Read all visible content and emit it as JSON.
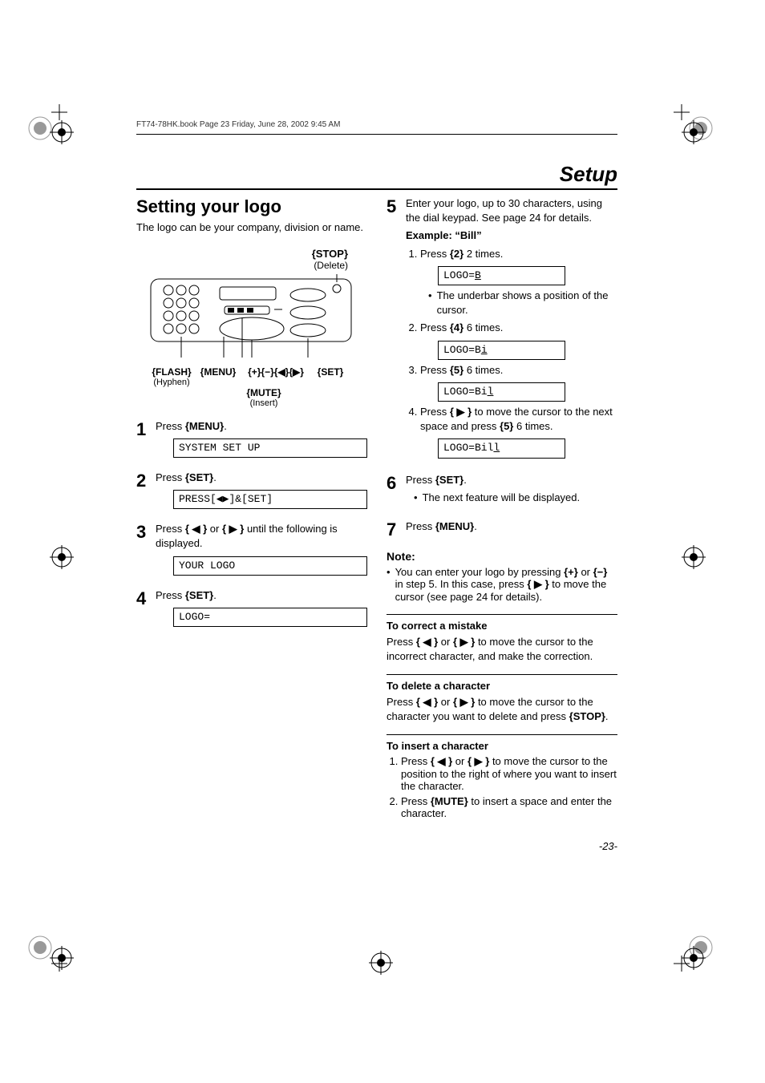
{
  "header": {
    "running": "FT74-78HK.book  Page 23  Friday, June 28, 2002  9:45 AM"
  },
  "section": "Setup",
  "title": "Setting your logo",
  "intro": "The logo can be your company, division or name.",
  "diagram": {
    "stop_label": "{STOP}",
    "stop_sub": "(Delete)",
    "flash_label": "{FLASH}",
    "flash_sub": "(Hyphen)",
    "menu_label": "{MENU}",
    "set_label": "{SET}",
    "arrows": "{+}{−}{◀}{▶}",
    "mute_label": "{MUTE}",
    "mute_sub": "(Insert)"
  },
  "left_steps": {
    "s1": {
      "num": "1",
      "text_a": "Press ",
      "btn": "{MENU}",
      "text_b": ".",
      "lcd": "SYSTEM SET UP"
    },
    "s2": {
      "num": "2",
      "text_a": "Press ",
      "btn": "{SET}",
      "text_b": ".",
      "lcd": "PRESS[◀▶]&[SET]"
    },
    "s3": {
      "num": "3",
      "text_a": "Press ",
      "btn1": "{ ◀ }",
      "text_mid": " or ",
      "btn2": "{ ▶ }",
      "text_b": " until the following is displayed.",
      "lcd": "YOUR LOGO"
    },
    "s4": {
      "num": "4",
      "text_a": "Press ",
      "btn": "{SET}",
      "text_b": ".",
      "lcd": "LOGO="
    }
  },
  "right_steps": {
    "s5": {
      "num": "5",
      "intro": "Enter your logo, up to 30 characters, using the dial keypad. See page 24 for details.",
      "example_label": "Example: “Bill”",
      "items": {
        "i1": {
          "pre": "Press ",
          "btn": "{2}",
          "post": " 2 times.",
          "lcd_pre": "LOGO=",
          "lcd_under": "B",
          "bullet": "The underbar shows a position of the cursor."
        },
        "i2": {
          "pre": "Press ",
          "btn": "{4}",
          "post": " 6 times.",
          "lcd_pre": "LOGO=B",
          "lcd_under": "i"
        },
        "i3": {
          "pre": "Press ",
          "btn": "{5}",
          "post": " 6 times.",
          "lcd_pre": "LOGO=Bi",
          "lcd_under": "l"
        },
        "i4": {
          "pre": "Press ",
          "btn": "{ ▶ }",
          "post_a": " to move the cursor to the next space and press ",
          "btn2": "{5}",
          "post_b": " 6 times.",
          "lcd_pre": "LOGO=Bil",
          "lcd_under": "l"
        }
      }
    },
    "s6": {
      "num": "6",
      "text_a": "Press ",
      "btn": "{SET}",
      "text_b": ".",
      "bullet": "The next feature will be displayed."
    },
    "s7": {
      "num": "7",
      "text_a": "Press ",
      "btn": "{MENU}",
      "text_b": "."
    }
  },
  "note": {
    "label": "Note:",
    "text_a": "You can enter your logo by pressing ",
    "btn_plus": "{+}",
    "text_b": " or ",
    "btn_minus": "{−}",
    "text_c": " in step 5. In this case, press ",
    "btn_right": "{ ▶ }",
    "text_d": " to move the cursor (see page 24 for details)."
  },
  "correct": {
    "heading": "To correct a mistake",
    "text_a": "Press ",
    "btn1": "{ ◀ }",
    "text_mid": " or ",
    "btn2": "{ ▶ }",
    "text_b": " to move the cursor to the incorrect character, and make the correction."
  },
  "deletec": {
    "heading": "To delete a character",
    "text_a": "Press ",
    "btn1": "{ ◀ }",
    "text_mid": " or ",
    "btn2": "{ ▶ }",
    "text_b": " to move the cursor to the character you want to delete and press ",
    "btn_stop": "{STOP}",
    "text_c": "."
  },
  "insertc": {
    "heading": "To insert a character",
    "i1_a": "Press ",
    "i1_btn1": "{ ◀ }",
    "i1_mid": " or ",
    "i1_btn2": "{ ▶ }",
    "i1_b": " to move the cursor to the position to the right of where you want to insert the character.",
    "i2_a": "Press ",
    "i2_btn": "{MUTE}",
    "i2_b": " to insert a space and enter the character."
  },
  "page_number": "-23-"
}
